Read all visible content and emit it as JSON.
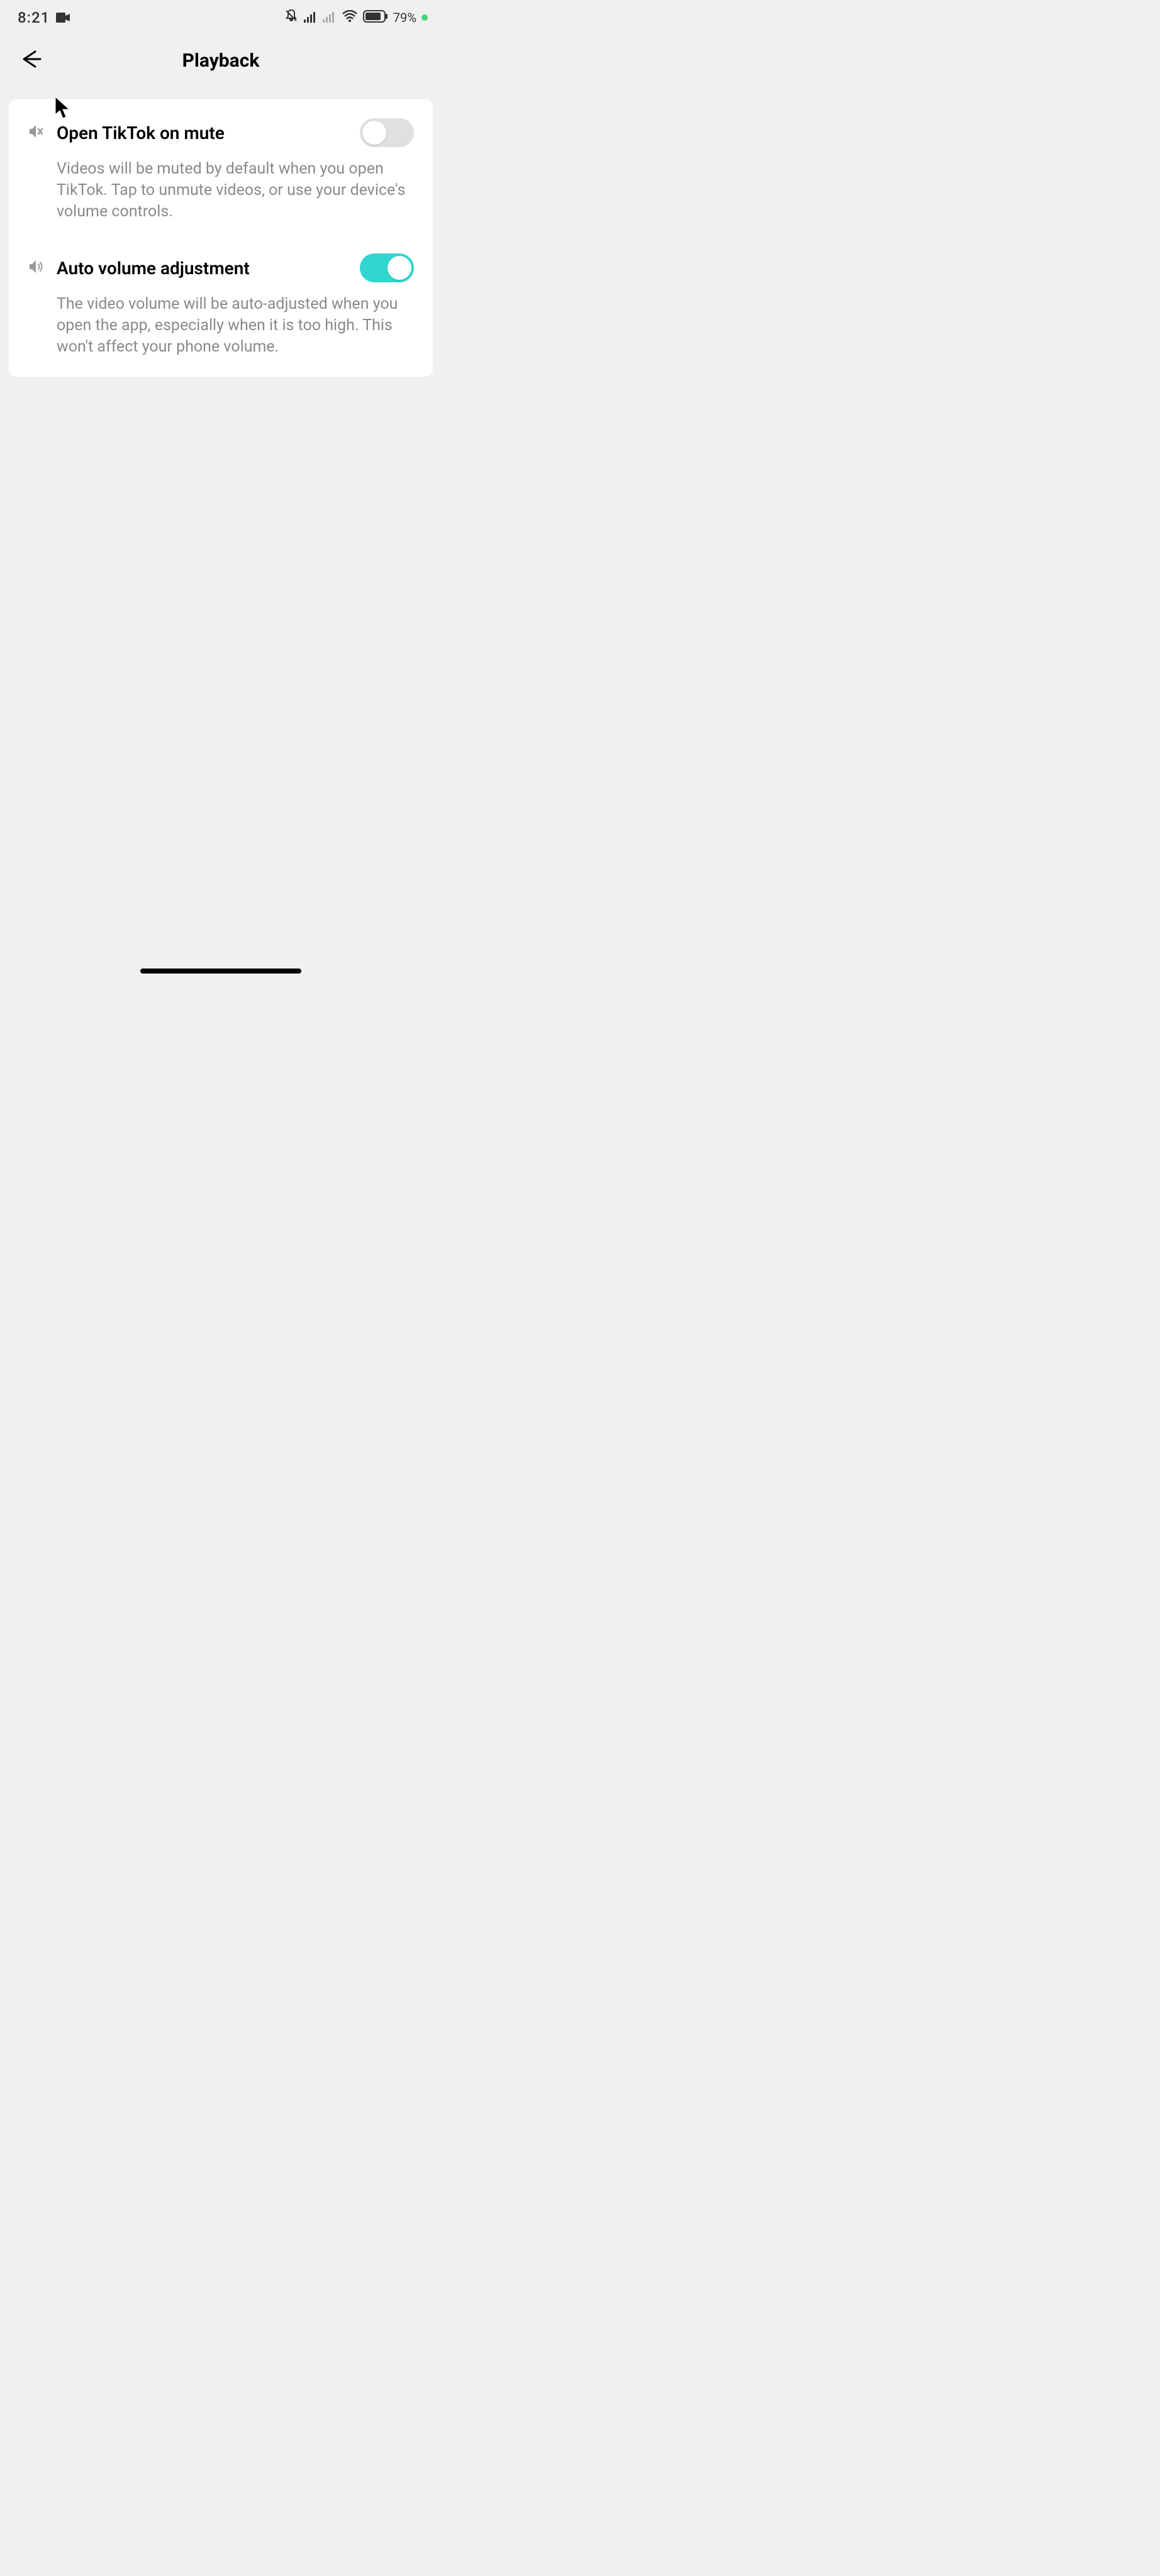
{
  "status_bar": {
    "time": "8:21",
    "battery_percent": "79%"
  },
  "header": {
    "title": "Playback"
  },
  "settings": [
    {
      "title": "Open TikTok on mute",
      "description": "Videos will be muted by default when you open TikTok. Tap to unmute videos, or use your device's volume controls.",
      "enabled": false,
      "icon": "speaker-mute"
    },
    {
      "title": "Auto volume adjustment",
      "description": "The video volume will be auto-adjusted when you open the app, especially when it is too high. This won't affect your phone volume.",
      "enabled": true,
      "icon": "speaker-volume"
    }
  ]
}
